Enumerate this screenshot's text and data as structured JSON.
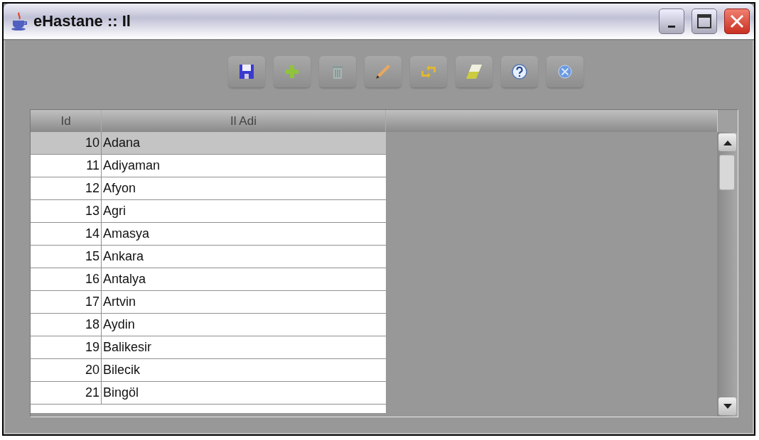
{
  "window": {
    "title": "eHastane :: Il"
  },
  "toolbar": [
    {
      "kind": "save"
    },
    {
      "kind": "add"
    },
    {
      "kind": "delete"
    },
    {
      "kind": "edit"
    },
    {
      "kind": "refresh"
    },
    {
      "kind": "clear"
    },
    {
      "kind": "help"
    },
    {
      "kind": "close"
    }
  ],
  "table": {
    "columns": [
      "Id",
      "Il Adi"
    ],
    "rows": [
      {
        "id": "10",
        "name": "Adana",
        "selected": true
      },
      {
        "id": "11",
        "name": "Adiyaman",
        "selected": false
      },
      {
        "id": "12",
        "name": "Afyon",
        "selected": false
      },
      {
        "id": "13",
        "name": "Agri",
        "selected": false
      },
      {
        "id": "14",
        "name": "Amasya",
        "selected": false
      },
      {
        "id": "15",
        "name": "Ankara",
        "selected": false
      },
      {
        "id": "16",
        "name": "Antalya",
        "selected": false
      },
      {
        "id": "17",
        "name": "Artvin",
        "selected": false
      },
      {
        "id": "18",
        "name": "Aydin",
        "selected": false
      },
      {
        "id": "19",
        "name": "Balikesir",
        "selected": false
      },
      {
        "id": "20",
        "name": "Bilecik",
        "selected": false
      },
      {
        "id": "21",
        "name": "Bingöl",
        "selected": false
      }
    ]
  }
}
